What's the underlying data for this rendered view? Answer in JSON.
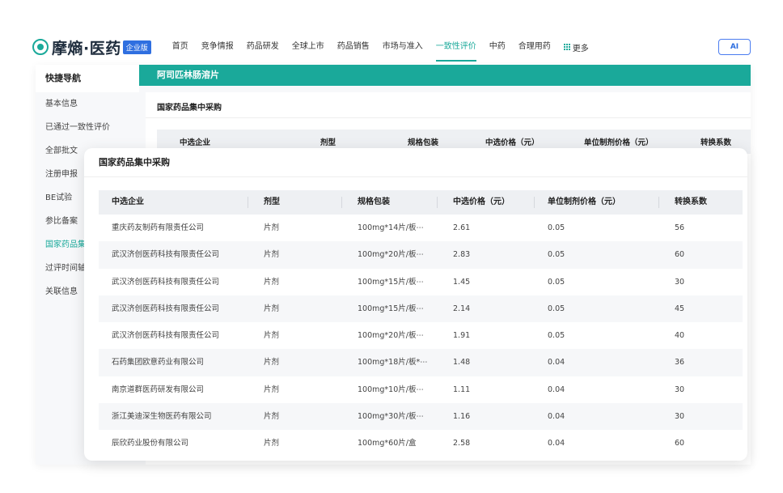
{
  "header": {
    "logo_text": "摩熵·医药",
    "logo_badge": "企业版",
    "menu": [
      "首页",
      "竞争情报",
      "药品研发",
      "全球上市",
      "药品销售",
      "市场与准入",
      "一致性评价",
      "中药",
      "合理用药"
    ],
    "active_menu": "一致性评价",
    "more_label": "更多",
    "ai_label": "AI"
  },
  "sidebar": {
    "title": "快捷导航",
    "items": [
      "基本信息",
      "已通过一致性评价",
      "全部批文",
      "注册申报",
      "BE试验",
      "参比备案",
      "国家药品集中采购",
      "过评时间轴",
      "关联信息"
    ],
    "active_item": "国家药品集中采购"
  },
  "drug": {
    "name": "阿司匹林肠溶片"
  },
  "back_section": {
    "title": "国家药品集中采购",
    "columns": [
      "中选企业",
      "剂型",
      "规格包装",
      "中选价格（元）",
      "单位制剂价格（元）",
      "转换系数"
    ]
  },
  "popup": {
    "title": "国家药品集中采购",
    "columns": [
      "中选企业",
      "剂型",
      "规格包装",
      "中选价格（元）",
      "单位制剂价格（元）",
      "转换系数"
    ],
    "rows": [
      [
        "重庆药友制药有限责任公司",
        "片剂",
        "100mg*14片/板⋯",
        "2.61",
        "0.05",
        "56"
      ],
      [
        "武汉济创医药科技有限责任公司",
        "片剂",
        "100mg*20片/板⋯",
        "2.83",
        "0.05",
        "60"
      ],
      [
        "武汉济创医药科技有限责任公司",
        "片剂",
        "100mg*15片/板⋯",
        "1.45",
        "0.05",
        "30"
      ],
      [
        "武汉济创医药科技有限责任公司",
        "片剂",
        "100mg*15片/板⋯",
        "2.14",
        "0.05",
        "45"
      ],
      [
        "武汉济创医药科技有限责任公司",
        "片剂",
        "100mg*20片/板⋯",
        "1.91",
        "0.05",
        "40"
      ],
      [
        "石药集团欧意药业有限公司",
        "片剂",
        "100mg*18片/板*⋯",
        "1.48",
        "0.04",
        "36"
      ],
      [
        "南京道群医药研发有限公司",
        "片剂",
        "100mg*10片/板⋯",
        "1.11",
        "0.04",
        "30"
      ],
      [
        "浙江美迪深生物医药有限公司",
        "片剂",
        "100mg*30片/板⋯",
        "1.16",
        "0.04",
        "30"
      ],
      [
        "辰欣药业股份有限公司",
        "片剂",
        "100mg*60片/盒",
        "2.58",
        "0.04",
        "60"
      ]
    ]
  },
  "colors": {
    "accent": "#1aa99a",
    "badge": "#2f6fe0"
  }
}
